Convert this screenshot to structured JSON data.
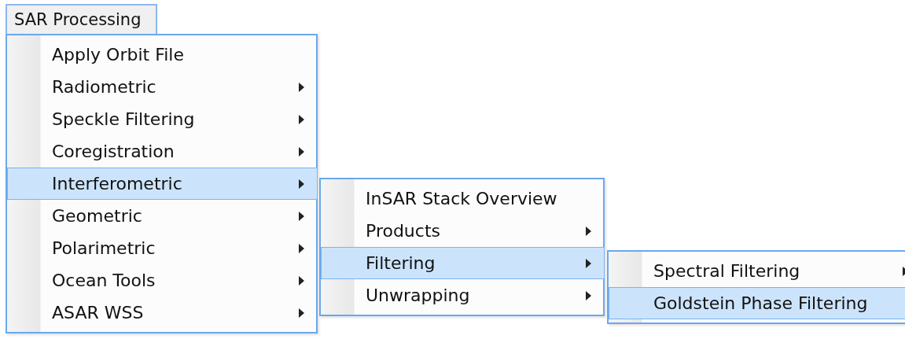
{
  "menubar": {
    "title": "SAR Processing"
  },
  "menus": [
    {
      "items": [
        {
          "label": "Apply Orbit File",
          "submenu": false,
          "selected": false
        },
        {
          "label": "Radiometric",
          "submenu": true,
          "selected": false
        },
        {
          "label": "Speckle Filtering",
          "submenu": true,
          "selected": false
        },
        {
          "label": "Coregistration",
          "submenu": true,
          "selected": false
        },
        {
          "label": "Interferometric",
          "submenu": true,
          "selected": true
        },
        {
          "label": "Geometric",
          "submenu": true,
          "selected": false
        },
        {
          "label": "Polarimetric",
          "submenu": true,
          "selected": false
        },
        {
          "label": "Ocean Tools",
          "submenu": true,
          "selected": false
        },
        {
          "label": "ASAR WSS",
          "submenu": true,
          "selected": false
        }
      ]
    },
    {
      "items": [
        {
          "label": "InSAR Stack Overview",
          "submenu": false,
          "selected": false
        },
        {
          "label": "Products",
          "submenu": true,
          "selected": false
        },
        {
          "label": "Filtering",
          "submenu": true,
          "selected": true
        },
        {
          "label": "Unwrapping",
          "submenu": true,
          "selected": false
        }
      ]
    },
    {
      "items": [
        {
          "label": "Spectral Filtering",
          "submenu": true,
          "selected": false
        },
        {
          "label": "Goldstein Phase Filtering",
          "submenu": false,
          "selected": true
        }
      ]
    }
  ]
}
